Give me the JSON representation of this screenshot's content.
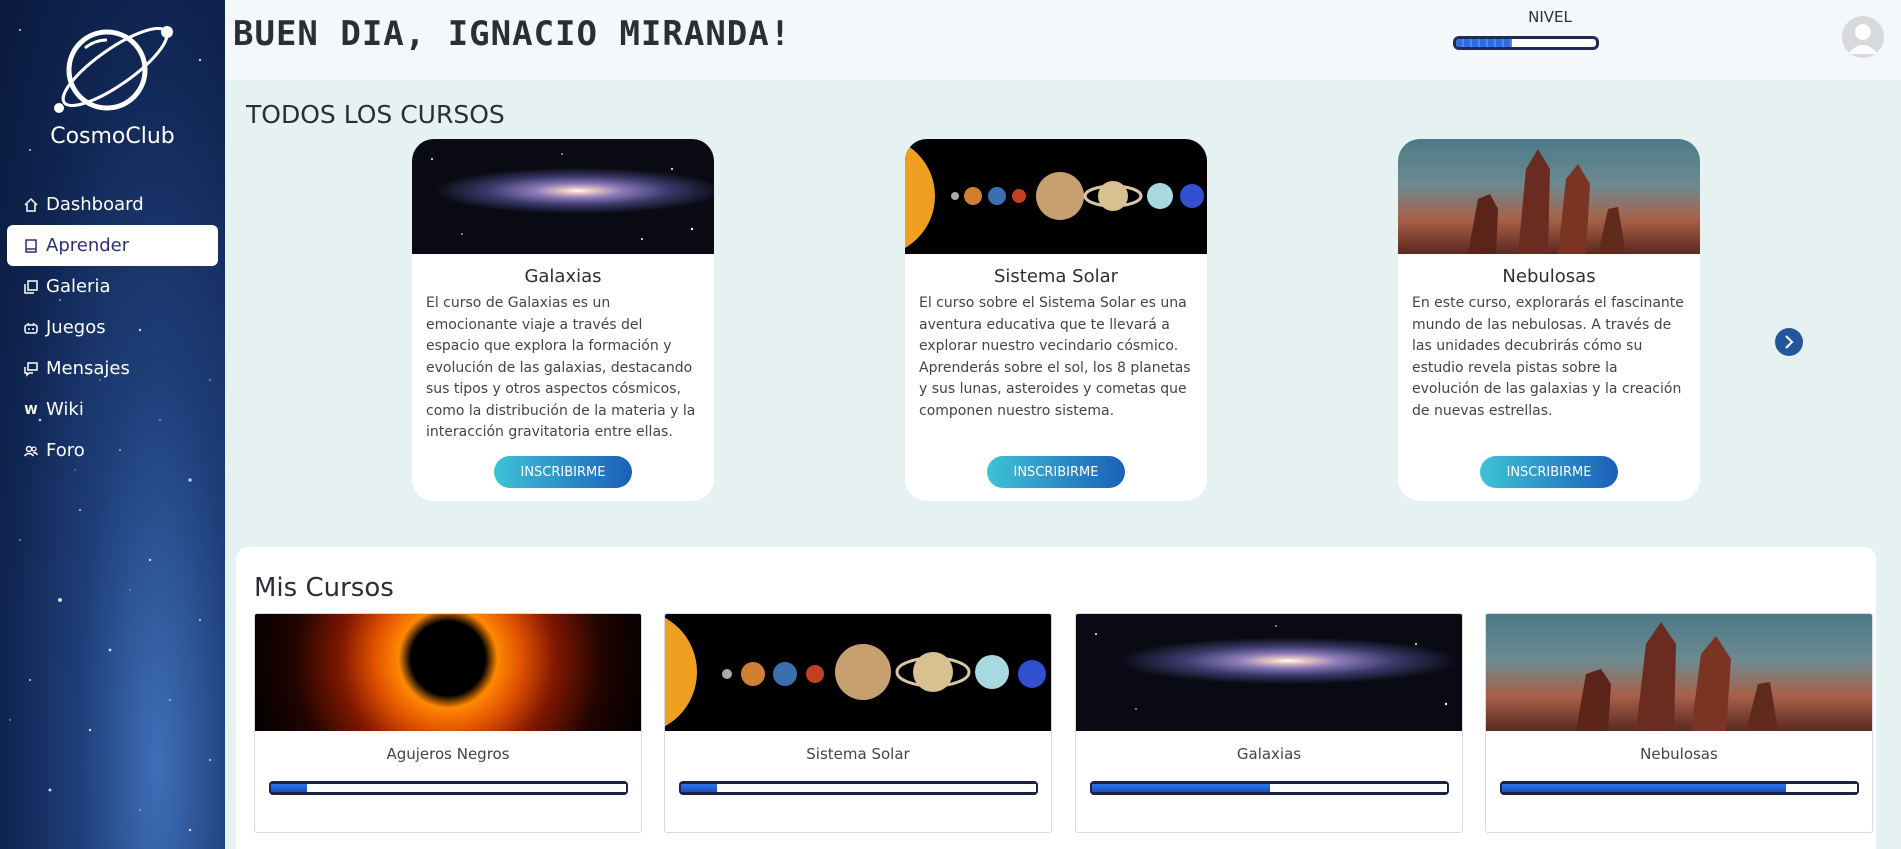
{
  "app": {
    "brand": "CosmoClub"
  },
  "sidebar": {
    "items": [
      {
        "label": "Dashboard",
        "icon": "home-icon",
        "active": false
      },
      {
        "label": "Aprender",
        "icon": "book-icon",
        "active": true
      },
      {
        "label": "Galeria",
        "icon": "gallery-icon",
        "active": false
      },
      {
        "label": "Juegos",
        "icon": "gamepad-icon",
        "active": false
      },
      {
        "label": "Mensajes",
        "icon": "chat-icon",
        "active": false
      },
      {
        "label": "Wiki",
        "icon": "wiki-icon",
        "active": false
      },
      {
        "label": "Foro",
        "icon": "users-icon",
        "active": false
      }
    ]
  },
  "header": {
    "greeting": "BUEN DIA, IGNACIO MIRANDA!",
    "level_label": "NIVEL",
    "level_progress": 0.4
  },
  "all_courses": {
    "title": "TODOS LOS CURSOS",
    "enroll_label": "INSCRIBIRME",
    "cards": [
      {
        "title": "Galaxias",
        "description": "El curso de Galaxias es un emocionante viaje a través del espacio que explora la formación y evolución de las galaxias, destacando sus tipos y otros aspectos cósmicos, como la distribución de la materia y la interacción gravitatoria entre ellas.",
        "image": "galaxy"
      },
      {
        "title": "Sistema Solar",
        "description": "El curso sobre el Sistema Solar es una aventura educativa que te llevará a explorar nuestro vecindario cósmico. Aprenderás sobre el sol, los 8 planetas y sus lunas, asteroides y cometas que componen nuestro sistema.",
        "image": "solar-system"
      },
      {
        "title": "Nebulosas",
        "description": "En este curso, explorarás el fascinante mundo de las nebulosas. A través de las unidades decubrirás cómo su estudio revela pistas sobre la evolución de las galaxias y la creación de nuevas estrellas.",
        "image": "nebula"
      }
    ]
  },
  "my_courses": {
    "title": "Mis Cursos",
    "cards": [
      {
        "title": "Agujeros Negros",
        "progress": 0.1,
        "image": "black-hole"
      },
      {
        "title": "Sistema Solar",
        "progress": 0.1,
        "image": "solar-system"
      },
      {
        "title": "Galaxias",
        "progress": 0.5,
        "image": "galaxy"
      },
      {
        "title": "Nebulosas",
        "progress": 0.8,
        "image": "nebula"
      }
    ]
  },
  "colors": {
    "sidebar": "#0f2450",
    "accent": "#1b5fb8",
    "enroll_start": "#3ec3d6",
    "bar_fill": "#2b74e8"
  }
}
